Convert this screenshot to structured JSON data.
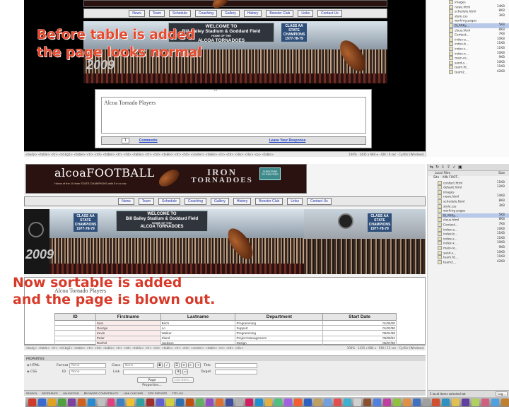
{
  "annotations": {
    "before_line1": "Before table is added",
    "before_line2": "the page looks normal",
    "after_line1": "Now sortable is added",
    "after_line2": "and the page is blown out."
  },
  "nav_items": [
    "News",
    "Team",
    "Schedule",
    "Coaching",
    "Gallery",
    "History",
    "Booster Club",
    "Links",
    "Contact Us"
  ],
  "banner": {
    "welcome": "WELCOME TO",
    "stadium": "Bill Bailey Stadium & Goddard Field",
    "home_of": "HOME OF THE",
    "team": "ALCOA TORNADOES",
    "champ_lines": [
      "CLASS AA",
      "STATE",
      "CHAMPIONS",
      "1977-78-79"
    ],
    "year": "2009"
  },
  "top_page": {
    "players_title": "Alcoa Tornado Players",
    "page_number": "1",
    "comments_link": "Comments",
    "leave_response_link": "Leave Your Response",
    "status_tags": "<body> <table> <tr> <td.bg1> <table> <tr> <td> <table> <tr> <td> <table> <tr> <td> <table> <tr> <td> <center> <table> <tr> <td> <div> <div> <p> <table>",
    "status_info": "100% · 1435 x 684 ▾ · 42K / 6 sec · Cyrillic (Windows)"
  },
  "bottom_page": {
    "logo": "alcoaFOOTBALL",
    "logo_sub": "Home of the 10 time STATE CHAMPIONS with 5 in a row",
    "iron_line1": "IRON",
    "iron_line2": "TORNADOES",
    "subscribe_line1": "SUBSCRIBE",
    "subscribe_line2": "TO RSS FEED",
    "players_title": "Alcoa Tornado Players",
    "status_tags": "<body> <table> <tr> <td.bg1> <table> <tr> <td> <table> <tr> <td> <table> <tr> <td> <table> <tr> <td> <center> <table> <tr> <td> <div>",
    "status_info": "100% · 1435 x 684 ▾ · 91K / 13 sec · Cyrillic (Windows)"
  },
  "table": {
    "columns": [
      "ID",
      "Firstname",
      "Lastname",
      "Department",
      "Start Date"
    ],
    "rows": [
      [
        "",
        "Sam",
        "Birch",
        "Programming",
        "01/06/00"
      ],
      [
        "",
        "George",
        "Lo",
        "Support",
        "01/02/90"
      ],
      [
        "",
        "Kevin",
        "Walker",
        "Programming",
        "09/04/98"
      ],
      [
        "",
        "Peter",
        "Irland",
        "Project Management",
        "05/09/94"
      ],
      [
        "",
        "Rachel",
        "Jackson",
        "Design",
        "05/07/99"
      ],
      [
        "",
        "Ken",
        "Clark",
        "Design",
        ""
      ],
      [
        "",
        "Eric",
        "Rice",
        "Support",
        ""
      ]
    ]
  },
  "files_top": {
    "rows": [
      {
        "name": "images",
        "size": ""
      },
      {
        "name": "news.html",
        "size": "14KB"
      },
      {
        "name": "schedule.html",
        "size": "8KB"
      },
      {
        "name": "style.css",
        "size": "3KB"
      },
      {
        "name": "working pages",
        "size": ""
      },
      {
        "name": "BLANKp...",
        "size": "5KB"
      },
      {
        "name": "clous.html",
        "size": "8KB"
      },
      {
        "name": "Contact...",
        "size": "7KB"
      },
      {
        "name": "index-a...",
        "size": "10KB"
      },
      {
        "name": "index-b...",
        "size": "11KB"
      },
      {
        "name": "index-s...",
        "size": "11KB"
      },
      {
        "name": "index-x...",
        "size": "10KB"
      },
      {
        "name": "main-re...",
        "size": "9KB"
      },
      {
        "name": "sand-s...",
        "size": "10KB"
      },
      {
        "name": "team.ht...",
        "size": "11KB"
      },
      {
        "name": "team2...",
        "size": "42KB"
      }
    ]
  },
  "files_bottom": {
    "header_title": "Local Files",
    "header_size": "Size",
    "site_label": "Site - Alfb FOOT...",
    "status": "1 local items selected tot",
    "log_button": "Log...",
    "rows": [
      {
        "name": "contact.html",
        "size": "11KB"
      },
      {
        "name": "default.html",
        "size": "12KB"
      },
      {
        "name": "images",
        "size": ""
      },
      {
        "name": "news.html",
        "size": "14KB"
      },
      {
        "name": "schedule.html",
        "size": "8KB"
      },
      {
        "name": "style.css",
        "size": "3KB"
      },
      {
        "name": "working pages",
        "size": ""
      },
      {
        "name": "BLANKp...",
        "size": "5KB"
      },
      {
        "name": "clous.html",
        "size": "8KB"
      },
      {
        "name": "Contact...",
        "size": "7KB"
      },
      {
        "name": "index-a...",
        "size": "10KB"
      },
      {
        "name": "index-b...",
        "size": "11KB"
      },
      {
        "name": "index-s...",
        "size": "11KB"
      },
      {
        "name": "index-x...",
        "size": "10KB"
      },
      {
        "name": "main-re...",
        "size": "9KB"
      },
      {
        "name": "sand-s...",
        "size": "10KB"
      },
      {
        "name": "team.ht...",
        "size": "11KB"
      },
      {
        "name": "team2...",
        "size": "42KB"
      }
    ]
  },
  "properties": {
    "title": "PROPERTIES",
    "html_label": "HTML",
    "css_label": "CSS",
    "format_label": "Format",
    "format_value": "None",
    "class_label": "Class",
    "class_value": "None",
    "bold": "B",
    "italic": "I",
    "title_label": "Title",
    "id_label": "ID",
    "id_value": "None",
    "link_label": "Link",
    "target_label": "Target",
    "page_props_button": "Page Properties...",
    "list_item_button": "List Item..."
  },
  "bottom_tabs": [
    "SEARCH",
    "REFERENCE",
    "VALIDATION",
    "BROWSER COMPATIBILITY",
    "LINK CHECKER",
    "SITE REPORTS",
    "FTP LOG"
  ],
  "colors": {
    "annotation_red": "#e64a2e",
    "link_blue": "#2244cc",
    "banner_maroon": "#2a1210"
  }
}
